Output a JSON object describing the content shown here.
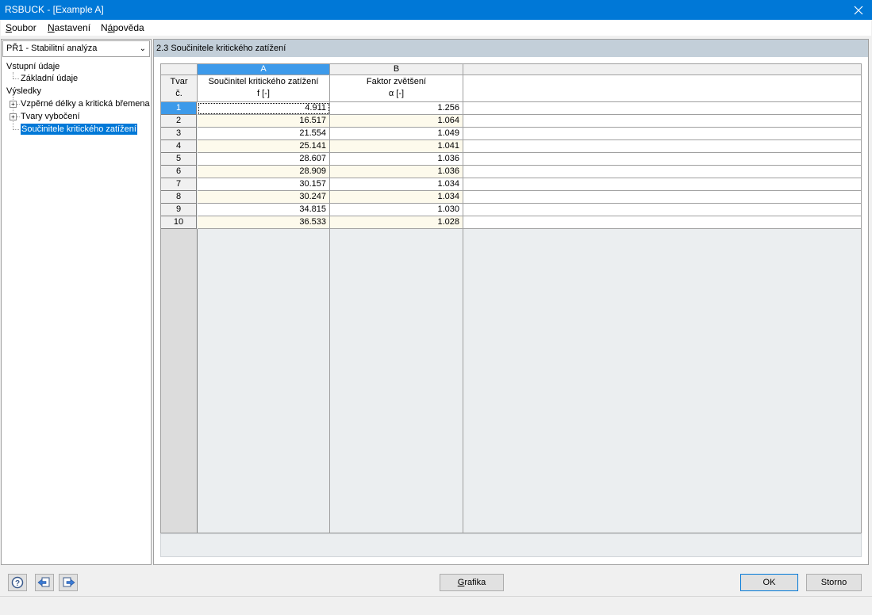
{
  "window": {
    "title": "RSBUCK - [Example A]"
  },
  "menu": [
    {
      "pre": "",
      "ul": "S",
      "post": "oubor"
    },
    {
      "pre": "",
      "ul": "N",
      "post": "astavení"
    },
    {
      "pre": "N",
      "ul": "á",
      "post": "pověda"
    }
  ],
  "case_selector": {
    "value": "PŘ1 - Stabilitní analýza"
  },
  "tree": {
    "input_group": "Vstupní údaje",
    "input_basic": "Základní údaje",
    "results_group": "Výsledky",
    "buckling_lengths": "Vzpěrné délky a kritická břemena",
    "buckling_shapes": "Tvary vybočení",
    "critical_factors": "Součinitele kritického zatížení"
  },
  "section": {
    "title": "2.3 Součinitele kritického zatížení"
  },
  "table": {
    "col_letters": [
      "A",
      "B"
    ],
    "row_header": {
      "line1": "Tvar",
      "line2": "č."
    },
    "col_a": {
      "line1": "Součinitel kritického zatížení",
      "line2": "f [-]"
    },
    "col_b": {
      "line1": "Faktor zvětšení",
      "line2": "α [-]"
    },
    "rows": [
      {
        "no": "1",
        "f": "4.911",
        "alpha": "1.256"
      },
      {
        "no": "2",
        "f": "16.517",
        "alpha": "1.064"
      },
      {
        "no": "3",
        "f": "21.554",
        "alpha": "1.049"
      },
      {
        "no": "4",
        "f": "25.141",
        "alpha": "1.041"
      },
      {
        "no": "5",
        "f": "28.607",
        "alpha": "1.036"
      },
      {
        "no": "6",
        "f": "28.909",
        "alpha": "1.036"
      },
      {
        "no": "7",
        "f": "30.157",
        "alpha": "1.034"
      },
      {
        "no": "8",
        "f": "30.247",
        "alpha": "1.034"
      },
      {
        "no": "9",
        "f": "34.815",
        "alpha": "1.030"
      },
      {
        "no": "10",
        "f": "36.533",
        "alpha": "1.028"
      }
    ]
  },
  "footer": {
    "graphics": {
      "pre": "",
      "ul": "G",
      "post": "rafika"
    },
    "ok": "OK",
    "cancel": "Storno",
    "icons": [
      "help-icon",
      "previous-icon",
      "next-icon"
    ]
  },
  "colors": {
    "accent": "#0078d7",
    "selection": "#3d9aea",
    "section_bg": "#c3cfd9",
    "row_alt": "#fdfaec"
  }
}
